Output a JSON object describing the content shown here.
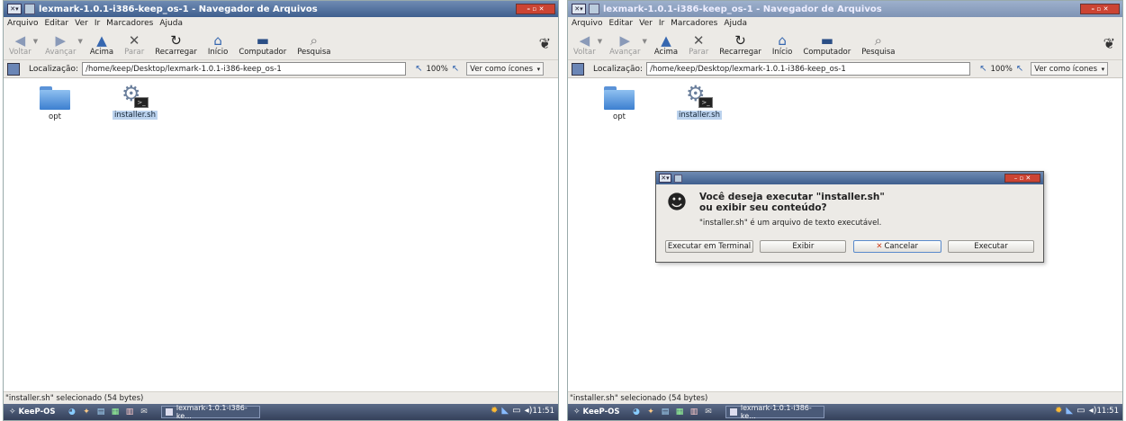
{
  "window": {
    "title": "lexmark-1.0.1-i386-keep_os-1 - Navegador de Arquivos",
    "menu_glyph": "✕▾",
    "controls": "– ▫ ✕"
  },
  "menu": [
    "Arquivo",
    "Editar",
    "Ver",
    "Ir",
    "Marcadores",
    "Ajuda"
  ],
  "toolbar": {
    "back": "Voltar",
    "forward": "Avançar",
    "up": "Acima",
    "stop": "Parar",
    "reload": "Recarregar",
    "home": "Início",
    "computer": "Computador",
    "search": "Pesquisa"
  },
  "location": {
    "label": "Localização:",
    "path": "/home/keep/Desktop/lexmark-1.0.1-i386-keep_os-1",
    "zoom": "100%",
    "view_mode": "Ver como ícones"
  },
  "files": [
    {
      "name": "opt",
      "type": "folder",
      "selected": false
    },
    {
      "name": "installer.sh",
      "type": "script",
      "selected": true
    }
  ],
  "status": "\"installer.sh\" selecionado (54 bytes)",
  "taskbar": {
    "start": "KeeP-OS",
    "task": "lexmark-1.0.1-i386-ke...",
    "clock": "11:51"
  },
  "dialog": {
    "heading_line1": "Você deseja executar \"installer.sh\"",
    "heading_line2": "ou exibir seu conteúdo?",
    "subtext": "\"installer.sh\" é um arquivo de texto executável.",
    "buttons": {
      "terminal": "Executar em Terminal",
      "display": "Exibir",
      "cancel": "Cancelar",
      "run": "Executar"
    }
  },
  "icons": {
    "back": "arrow-left-icon",
    "forward": "arrow-right-icon",
    "up": "arrow-up-icon",
    "stop": "stop-x-icon",
    "reload": "reload-icon",
    "home": "home-icon",
    "computer": "computer-icon",
    "search": "search-icon"
  },
  "colors": {
    "titlebar": "#3f5f8e",
    "selection": "#bcd3ee",
    "taskbar": "#34405a"
  }
}
